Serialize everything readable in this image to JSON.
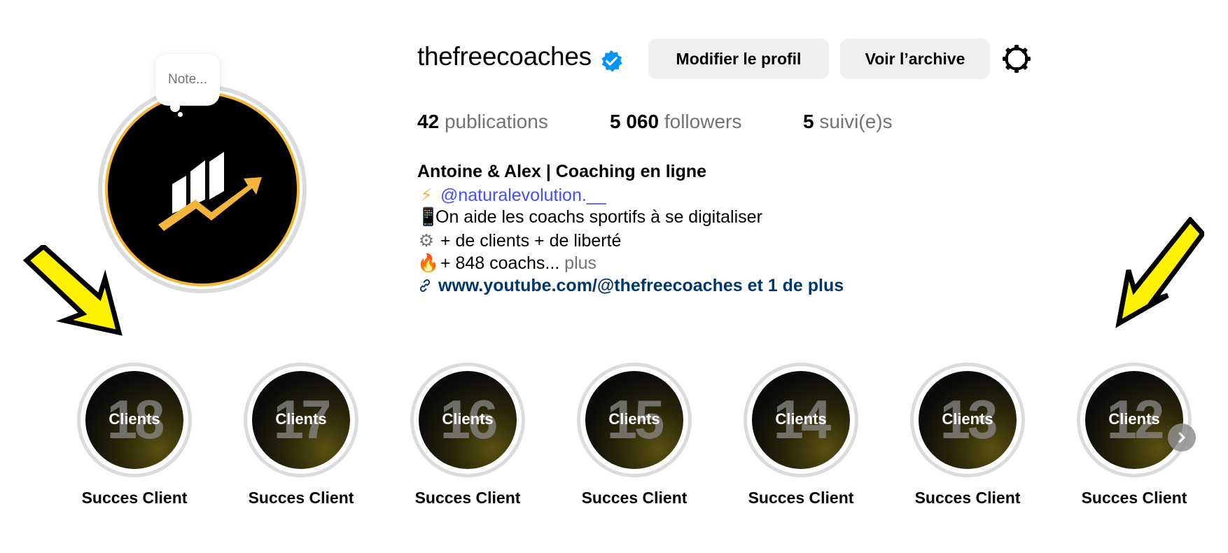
{
  "note": {
    "placeholder": "Note..."
  },
  "profile": {
    "username": "thefreecoaches",
    "edit_button": "Modifier le profil",
    "archive_button": "Voir l’archive"
  },
  "stats": {
    "posts_count": "42",
    "posts_label": "publications",
    "followers_count": "5 060",
    "followers_label": "followers",
    "following_count": "5",
    "following_label": "suivi(e)s"
  },
  "bio": {
    "name": "Antoine & Alex | Coaching en ligne",
    "line2_emoji": "⚡",
    "mention": "@naturalevolution.__",
    "line3_emoji": "📱",
    "line3_text": "On aide les coachs sportifs à se digitaliser",
    "line4_emoji": "⚙",
    "line4_text": "+ de clients + de liberté",
    "line5_emoji": "🔥",
    "line5_text": "+ 848 coachs...",
    "line5_more": "plus",
    "link_text": "www.youtube.com/@thefreecoaches et 1 de plus"
  },
  "highlights": [
    {
      "number": "18",
      "word": "Clients",
      "label": "Succes Client"
    },
    {
      "number": "17",
      "word": "Clients",
      "label": "Succes Client"
    },
    {
      "number": "16",
      "word": "Clients",
      "label": "Succes Client"
    },
    {
      "number": "15",
      "word": "Clients",
      "label": "Succes Client"
    },
    {
      "number": "14",
      "word": "Clients",
      "label": "Succes Client"
    },
    {
      "number": "13",
      "word": "Clients",
      "label": "Succes Client"
    },
    {
      "number": "12",
      "word": "Clients",
      "label": "Succes Client"
    }
  ],
  "colors": {
    "avatar_gold": "#f3b53a",
    "verified_blue": "#0095f6",
    "mention_blue": "#4150f7",
    "link_blue": "#00376b",
    "arrow_yellow": "#fff200"
  }
}
